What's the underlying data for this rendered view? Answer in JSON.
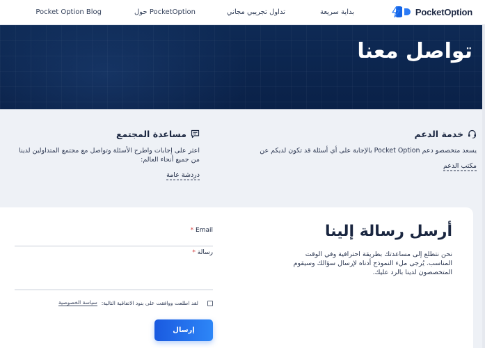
{
  "header": {
    "logo_text": "PocketOption",
    "nav": [
      {
        "label": "بداية سريعة"
      },
      {
        "label": "تداول تجريبي مجاني"
      },
      {
        "label": "حول PocketOption"
      },
      {
        "label": "Pocket Option Blog"
      }
    ],
    "icons": {
      "bolt": "lightning-icon",
      "logo": "pocketoption-logo"
    }
  },
  "hero": {
    "title": "تواصل معنا"
  },
  "support": {
    "support_card": {
      "title": "خدمة الدعم",
      "description": "يسعد متخصصو دعم Pocket Option بالإجابة على أي أسئلة قد تكون لديكم عن",
      "link": "مكتب الدعم",
      "icon": "headset-icon"
    },
    "community_card": {
      "title": "مساعدة المجتمع",
      "description": "اعثر على إجابات واطرح الأسئلة وتواصل مع مجتمع المتداولين لدينا من جميع أنحاء العالم:",
      "link": "دردشة عامة",
      "icon": "chat-icon"
    }
  },
  "form": {
    "title": "أرسل رسالة إلينا",
    "description": "نحن نتطلع إلى مساعدتك بطريقة احترافية وفي الوقت المناسب. يُرجى ملء النموذج أدناه لإرسال سؤالك وسيقوم المتخصصون لدينا بالرد عليك.",
    "email_label": "Email",
    "message_label": "رسالة",
    "required_mark": "*",
    "consent_text": "لقد اطلعت ووافقت على بنود الاتفاقية التالية:",
    "privacy_link": "سياسة الخصوصية",
    "submit_label": "إرسال"
  },
  "colors": {
    "brand": "#1565e6",
    "hero_bg": "#0a2148",
    "button": "#2d86f7",
    "text": "#1a2640"
  }
}
